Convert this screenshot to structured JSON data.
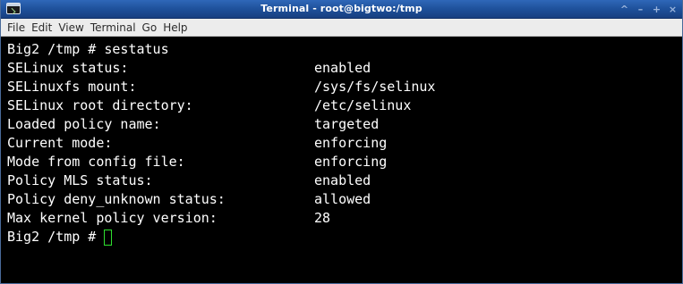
{
  "window": {
    "title": "Terminal - root@bigtwo:/tmp",
    "icon": "terminal-icon",
    "controls": [
      {
        "name": "scroll-up-icon",
        "glyph": "^"
      },
      {
        "name": "minimize-icon",
        "glyph": "–"
      },
      {
        "name": "maximize-icon",
        "glyph": "+"
      },
      {
        "name": "close-icon",
        "glyph": "×"
      }
    ]
  },
  "menu": {
    "items": [
      "File",
      "Edit",
      "View",
      "Terminal",
      "Go",
      "Help"
    ]
  },
  "terminal": {
    "command_line": "Big2 /tmp # sestatus",
    "rows": [
      {
        "label": "SELinux status:",
        "value": "enabled"
      },
      {
        "label": "SELinuxfs mount:",
        "value": "/sys/fs/selinux"
      },
      {
        "label": "SELinux root directory:",
        "value": "/etc/selinux"
      },
      {
        "label": "Loaded policy name:",
        "value": "targeted"
      },
      {
        "label": "Current mode:",
        "value": "enforcing"
      },
      {
        "label": "Mode from config file:",
        "value": "enforcing"
      },
      {
        "label": "Policy MLS status:",
        "value": "enabled"
      },
      {
        "label": "Policy deny_unknown status:",
        "value": "allowed"
      },
      {
        "label": "Max kernel policy version:",
        "value": "28"
      }
    ],
    "prompt": "Big2 /tmp # "
  },
  "colors": {
    "titlebar": "#1d4f98",
    "terminal_bg": "#000000",
    "terminal_fg": "#ffffff",
    "cursor": "#2fe02f"
  }
}
